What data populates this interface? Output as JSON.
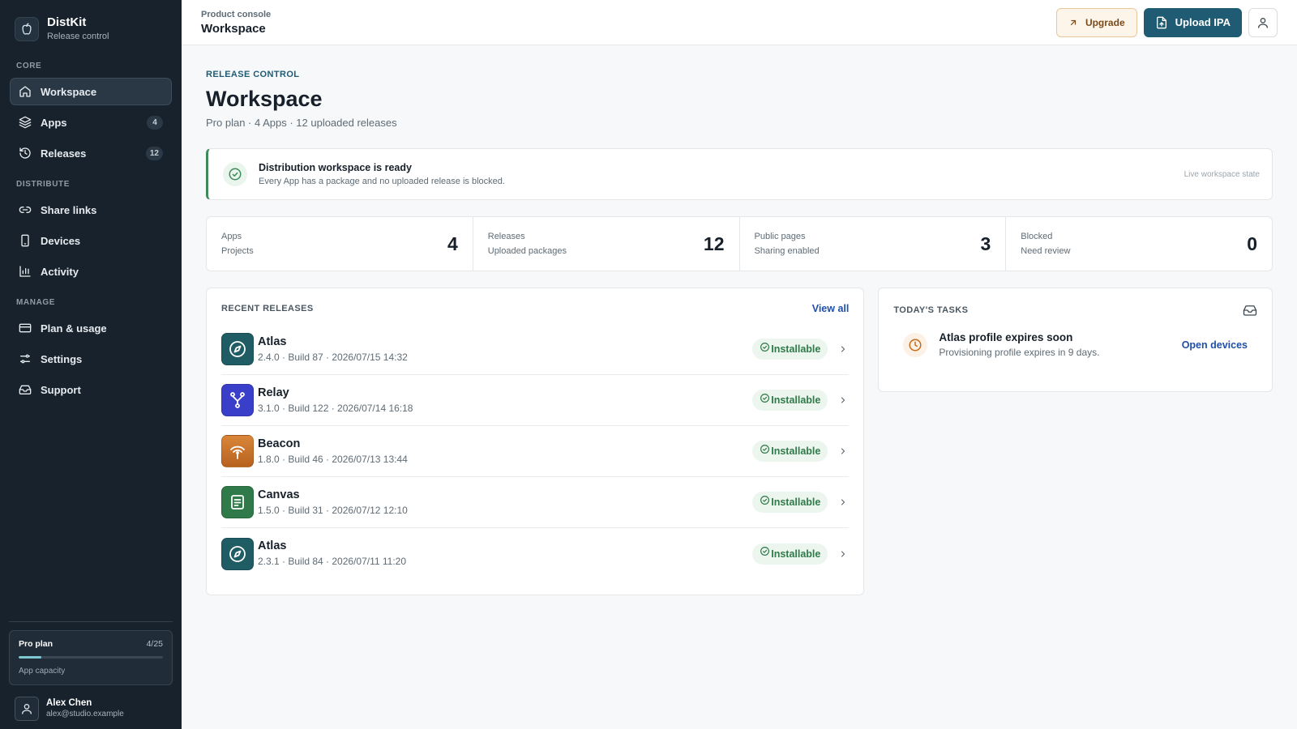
{
  "brand": {
    "name": "DistKit",
    "subtitle": "Release control"
  },
  "sidebar": {
    "sections": [
      {
        "label": "CORE"
      },
      {
        "label": "DISTRIBUTE"
      },
      {
        "label": "MANAGE"
      }
    ],
    "items": [
      {
        "label": "Workspace",
        "icon": "home-icon",
        "active": true
      },
      {
        "label": "Apps",
        "icon": "layers-icon",
        "count": "4"
      },
      {
        "label": "Releases",
        "icon": "history-icon",
        "count": "12"
      },
      {
        "label": "Share links",
        "icon": "link-icon"
      },
      {
        "label": "Devices",
        "icon": "phone-icon"
      },
      {
        "label": "Activity",
        "icon": "bar-chart-icon"
      },
      {
        "label": "Plan & usage",
        "icon": "credit-card-icon"
      },
      {
        "label": "Settings",
        "icon": "sliders-icon"
      },
      {
        "label": "Support",
        "icon": "inbox-icon"
      }
    ],
    "plan": {
      "title": "Pro plan",
      "count": "4/25",
      "subtitle": "App capacity",
      "fill_fraction": 0.16
    },
    "user": {
      "name": "Alex Chen",
      "email": "alex@studio.example"
    }
  },
  "topbar": {
    "sup": "Product console",
    "title": "Workspace",
    "upgrade_label": "Upgrade",
    "upload_label": "Upload IPA"
  },
  "header": {
    "eyebrow": "RELEASE CONTROL",
    "title": "Workspace",
    "meta": "Pro plan · 4 Apps · 12 uploaded releases"
  },
  "alert": {
    "title": "Distribution workspace is ready",
    "description": "Every App has a package and no uploaded release is blocked.",
    "state": "Live workspace state"
  },
  "stats": [
    {
      "label": "Apps",
      "sub": "Projects",
      "value": "4"
    },
    {
      "label": "Releases",
      "sub": "Uploaded packages",
      "value": "12"
    },
    {
      "label": "Public pages",
      "sub": "Sharing enabled",
      "value": "3"
    },
    {
      "label": "Blocked",
      "sub": "Need review",
      "value": "0"
    }
  ],
  "recent_releases": {
    "title": "RECENT RELEASES",
    "view_all": "View all",
    "items": [
      {
        "name": "Atlas",
        "meta": "2.4.0 · Build 87 · 2026/07/15 14:32",
        "status": "Installable",
        "icon": "compass-icon",
        "color": "#1f5c63"
      },
      {
        "name": "Relay",
        "meta": "3.1.0 · Build 122 · 2026/07/14 16:18",
        "status": "Installable",
        "icon": "fork-icon",
        "color": "#3a3fc9"
      },
      {
        "name": "Beacon",
        "meta": "1.8.0 · Build 46 · 2026/07/13 13:44",
        "status": "Installable",
        "icon": "broadcast-icon",
        "color": "#d07a2a"
      },
      {
        "name": "Canvas",
        "meta": "1.5.0 · Build 31 · 2026/07/12 12:10",
        "status": "Installable",
        "icon": "document-icon",
        "color": "#2f7a48"
      },
      {
        "name": "Atlas",
        "meta": "2.3.1 · Build 84 · 2026/07/11 11:20",
        "status": "Installable",
        "icon": "compass-icon",
        "color": "#1f5c63"
      }
    ]
  },
  "tasks": {
    "title": "TODAY'S TASKS",
    "items": [
      {
        "title": "Atlas profile expires soon",
        "description": "Provisioning profile expires in 9 days.",
        "action": "Open devices"
      }
    ]
  }
}
